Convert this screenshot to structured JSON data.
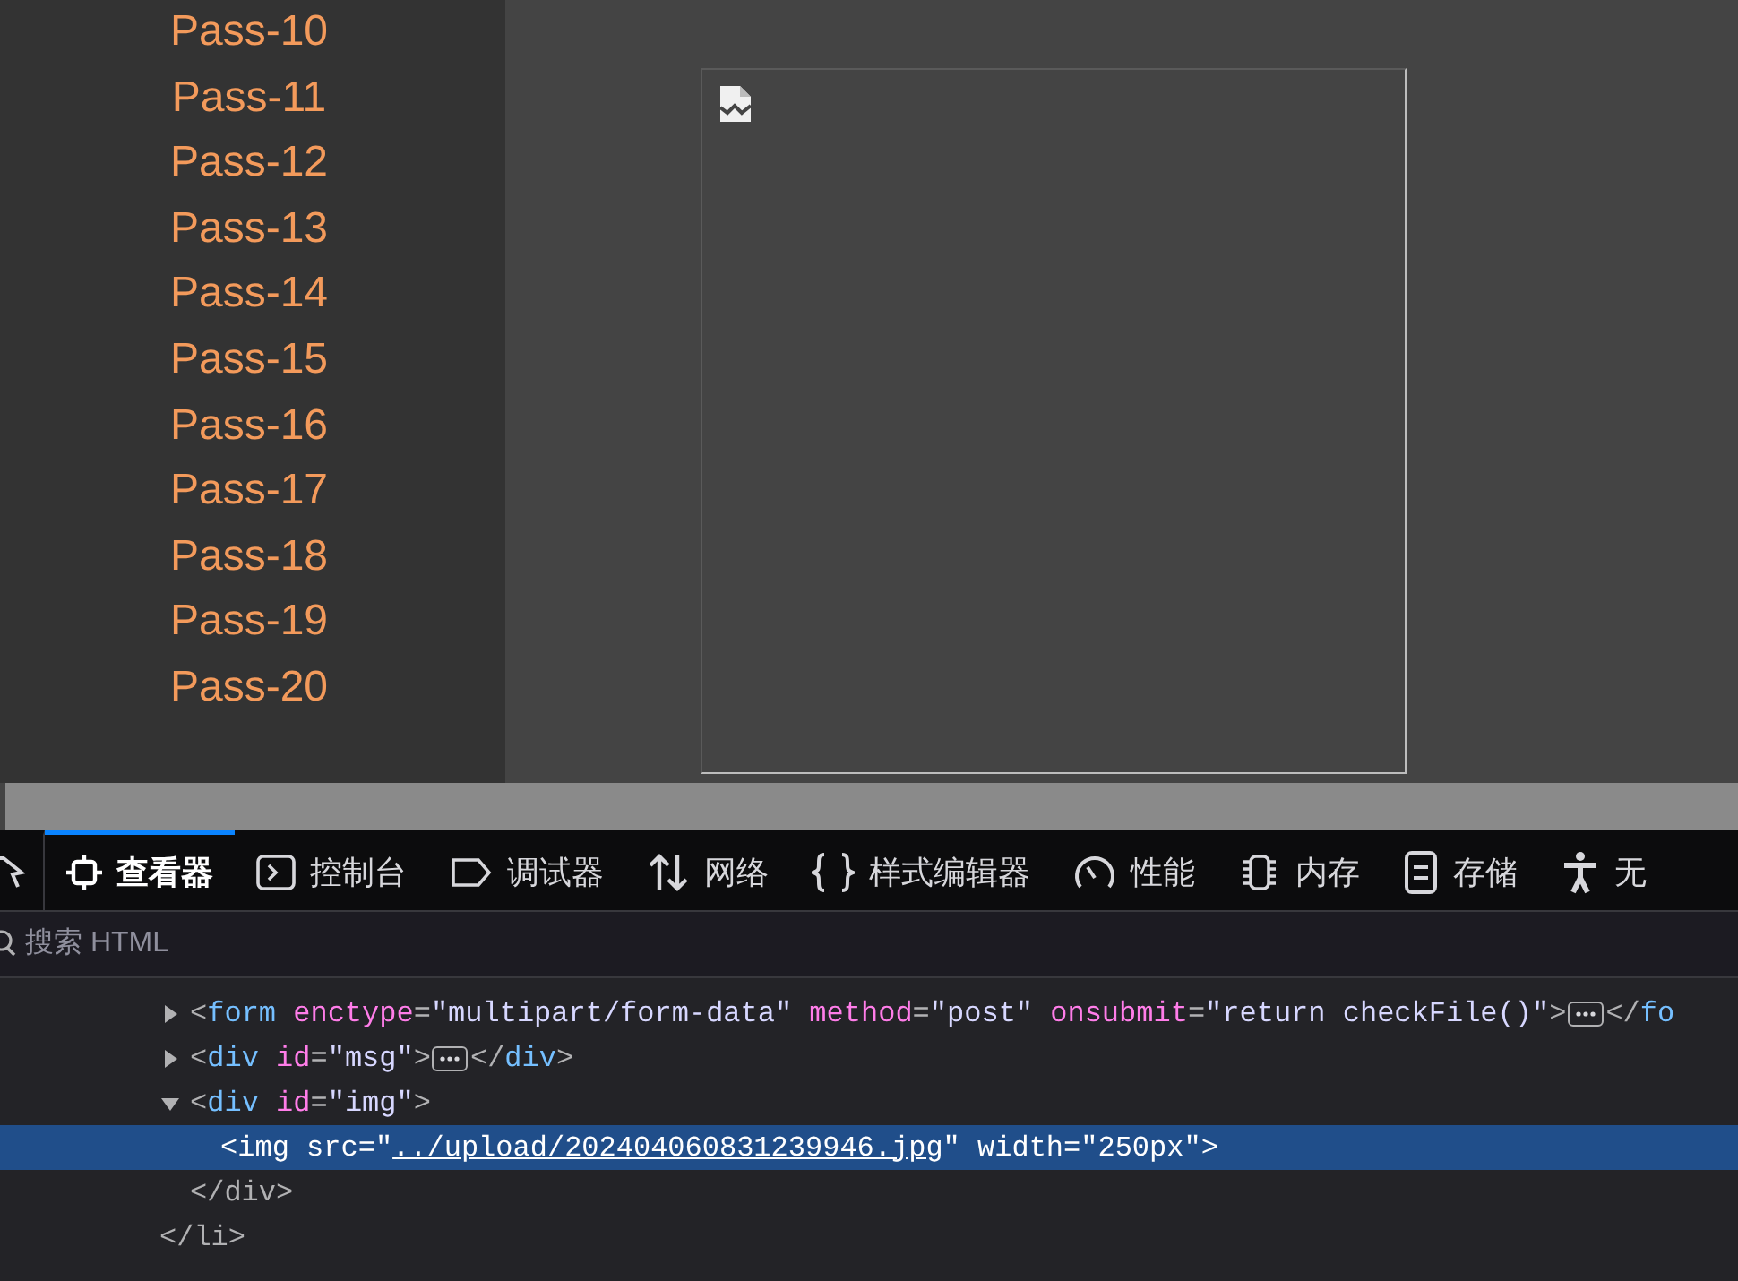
{
  "sidebar": {
    "items": [
      {
        "label": "Pass-10"
      },
      {
        "label": "Pass-11"
      },
      {
        "label": "Pass-12"
      },
      {
        "label": "Pass-13"
      },
      {
        "label": "Pass-14"
      },
      {
        "label": "Pass-15"
      },
      {
        "label": "Pass-16"
      },
      {
        "label": "Pass-17"
      },
      {
        "label": "Pass-18"
      },
      {
        "label": "Pass-19"
      },
      {
        "label": "Pass-20"
      }
    ]
  },
  "devtools": {
    "tabs": [
      {
        "kind": "picker",
        "selected": false
      },
      {
        "kind": "inspector",
        "label": "查看器",
        "selected": true
      },
      {
        "kind": "console",
        "label": "控制台",
        "selected": false
      },
      {
        "kind": "debugger",
        "label": "调试器",
        "selected": false
      },
      {
        "kind": "network",
        "label": "网络",
        "selected": false
      },
      {
        "kind": "style",
        "label": "样式编辑器",
        "selected": false
      },
      {
        "kind": "performance",
        "label": "性能",
        "selected": false
      },
      {
        "kind": "memory",
        "label": "内存",
        "selected": false
      },
      {
        "kind": "storage",
        "label": "存储",
        "selected": false
      },
      {
        "kind": "accessibility",
        "label": "无",
        "selected": false
      }
    ],
    "search": {
      "placeholder": "搜索 HTML"
    },
    "tree": [
      {
        "closing": "</li>",
        "children": [
          {
            "expanded": false,
            "selected": false,
            "tokens": [
              {
                "kind": "punct",
                "text": "<"
              },
              {
                "kind": "tag",
                "text": "form"
              },
              {
                "kind": "attr",
                "text": " enctype"
              },
              {
                "kind": "punct",
                "text": "="
              },
              {
                "kind": "value",
                "text": "\"multipart/form-data\""
              },
              {
                "kind": "attr",
                "text": " method"
              },
              {
                "kind": "punct",
                "text": "="
              },
              {
                "kind": "value",
                "text": "\"post\""
              },
              {
                "kind": "attr",
                "text": " onsubmit"
              },
              {
                "kind": "punct",
                "text": "="
              },
              {
                "kind": "value",
                "text": "\"return checkFile()\""
              },
              {
                "kind": "punct",
                "text": ">"
              },
              {
                "kind": "badge"
              },
              {
                "kind": "punct",
                "text": "</"
              },
              {
                "kind": "tag",
                "text": "fo"
              }
            ]
          },
          {
            "expanded": false,
            "selected": false,
            "tokens": [
              {
                "kind": "punct",
                "text": "<"
              },
              {
                "kind": "tag",
                "text": "div"
              },
              {
                "kind": "attr",
                "text": " id"
              },
              {
                "kind": "punct",
                "text": "="
              },
              {
                "kind": "value",
                "text": "\"msg\""
              },
              {
                "kind": "punct",
                "text": ">"
              },
              {
                "kind": "badge"
              },
              {
                "kind": "punct",
                "text": "</"
              },
              {
                "kind": "tag",
                "text": "div"
              },
              {
                "kind": "punct",
                "text": ">"
              }
            ]
          },
          {
            "expanded": true,
            "selected": false,
            "closing": "</div>",
            "tokens": [
              {
                "kind": "punct",
                "text": "<"
              },
              {
                "kind": "tag",
                "text": "div"
              },
              {
                "kind": "attr",
                "text": " id"
              },
              {
                "kind": "punct",
                "text": "="
              },
              {
                "kind": "value",
                "text": "\"img\""
              },
              {
                "kind": "punct",
                "text": ">"
              }
            ],
            "children": [
              {
                "selected": true,
                "tokens": [
                  {
                    "kind": "punct",
                    "text": "<"
                  },
                  {
                    "kind": "tag",
                    "text": "img"
                  },
                  {
                    "kind": "attr",
                    "text": " src"
                  },
                  {
                    "kind": "punct",
                    "text": "="
                  },
                  {
                    "kind": "value",
                    "text": "\""
                  },
                  {
                    "kind": "link",
                    "text": "../upload/202404060831239946.jpg"
                  },
                  {
                    "kind": "value",
                    "text": "\""
                  },
                  {
                    "kind": "attr",
                    "text": " width"
                  },
                  {
                    "kind": "punct",
                    "text": "="
                  },
                  {
                    "kind": "value",
                    "text": "\"250px\""
                  },
                  {
                    "kind": "punct",
                    "text": ">"
                  }
                ]
              }
            ]
          }
        ]
      }
    ]
  }
}
